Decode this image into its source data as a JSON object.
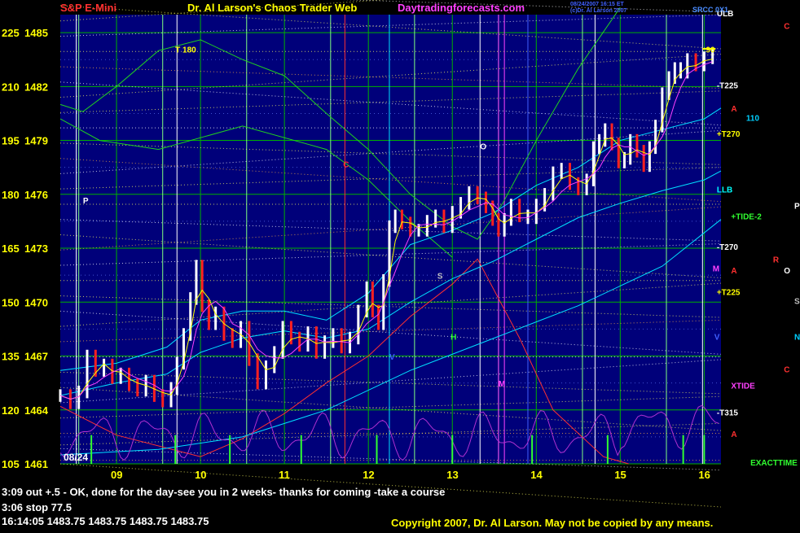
{
  "header": {
    "instrument": "S&P E-Mini",
    "title": "Dr. Al Larson's Chaos Trader Web",
    "site": "Daytradingforecasts.com",
    "timestamp_lines": [
      "08/24/2007 16:15 ET",
      "(c)Dr. Al Larson 2007"
    ],
    "corner_label": "SRCC 0X1",
    "colors": {
      "instrument": "#ff3030",
      "title": "#ffff00",
      "site": "#ff40ff",
      "timestamp": "#4060ff",
      "corner": "#4a8cff"
    }
  },
  "footer": {
    "note_line_1": "3:09 out +.5 - OK, done for the day-see you in 2 weeks- thanks for coming -take a course",
    "note_line_2": "3:06 stop 77.5",
    "quote_line": "16:14:05  1483.75 1483.75 1483.75 1483.75",
    "copyright": "Copyright 2007, Dr. Al Larson. May not be copied by any means."
  },
  "chart_data": {
    "type": "line",
    "date_label": "08/24",
    "x_ticks": [
      "09",
      "10",
      "11",
      "12",
      "13",
      "14",
      "15",
      "16"
    ],
    "x_tick_hours": [
      9,
      10,
      11,
      12,
      13,
      14,
      15,
      16
    ],
    "xlim": [
      8.33,
      16.2
    ],
    "ylim": [
      1461,
      1486
    ],
    "y_ticks": [
      {
        "offset": "225",
        "price": "1485",
        "value": 1485
      },
      {
        "offset": "210",
        "price": "1482",
        "value": 1482
      },
      {
        "offset": "195",
        "price": "1479",
        "value": 1479
      },
      {
        "offset": "180",
        "price": "1476",
        "value": 1476
      },
      {
        "offset": "165",
        "price": "1473",
        "value": 1473
      },
      {
        "offset": "150",
        "price": "1470",
        "value": 1470
      },
      {
        "offset": "135",
        "price": "1467",
        "value": 1467
      },
      {
        "offset": "120",
        "price": "1464",
        "value": 1464
      },
      {
        "offset": "105",
        "price": "1461",
        "value": 1461
      }
    ],
    "price_series": {
      "name": "",
      "color": "#ffffff",
      "x": [
        8.33,
        8.45,
        8.55,
        8.65,
        8.75,
        8.85,
        8.95,
        9.05,
        9.15,
        9.25,
        9.35,
        9.45,
        9.55,
        9.65,
        9.72,
        9.8,
        9.88,
        9.95,
        10.02,
        10.1,
        10.18,
        10.28,
        10.38,
        10.48,
        10.58,
        10.68,
        10.78,
        10.88,
        10.98,
        11.08,
        11.18,
        11.28,
        11.38,
        11.48,
        11.58,
        11.68,
        11.78,
        11.88,
        11.98,
        12.05,
        12.12,
        12.18,
        12.25,
        12.32,
        12.4,
        12.5,
        12.6,
        12.7,
        12.8,
        12.9,
        13.0,
        13.1,
        13.2,
        13.3,
        13.4,
        13.48,
        13.55,
        13.62,
        13.7,
        13.8,
        13.9,
        14.0,
        14.1,
        14.2,
        14.3,
        14.4,
        14.5,
        14.6,
        14.68,
        14.75,
        14.82,
        14.9,
        14.98,
        15.05,
        15.12,
        15.2,
        15.28,
        15.35,
        15.42,
        15.5,
        15.58,
        15.65,
        15.72,
        15.8,
        15.9,
        16.0,
        16.1
      ],
      "y": [
        1464.8,
        1464.4,
        1465.0,
        1467.0,
        1466.2,
        1466.5,
        1465.8,
        1466.0,
        1465.4,
        1465.1,
        1465.6,
        1464.8,
        1464.5,
        1465.2,
        1466.6,
        1468.2,
        1470.2,
        1472.0,
        1469.8,
        1468.8,
        1469.4,
        1468.2,
        1467.8,
        1468.6,
        1466.8,
        1465.5,
        1466.4,
        1467.2,
        1468.6,
        1468.0,
        1467.6,
        1468.3,
        1467.2,
        1467.8,
        1468.2,
        1467.5,
        1468.0,
        1469.5,
        1470.8,
        1469.5,
        1468.8,
        1471.2,
        1474.2,
        1474.8,
        1474.4,
        1474.0,
        1474.0,
        1474.5,
        1474.8,
        1474.2,
        1475.0,
        1475.5,
        1476.1,
        1475.8,
        1475.3,
        1474.6,
        1474.0,
        1474.6,
        1475.4,
        1474.8,
        1474.7,
        1475.4,
        1476.0,
        1477.2,
        1477.4,
        1476.6,
        1476.3,
        1476.8,
        1478.6,
        1479.0,
        1479.6,
        1478.8,
        1477.8,
        1478.0,
        1479.0,
        1478.4,
        1477.6,
        1478.6,
        1479.8,
        1481.6,
        1482.5,
        1483.0,
        1482.8,
        1483.5,
        1483.2,
        1483.6,
        1483.8
      ]
    },
    "annotations": [
      {
        "text": "T 180",
        "x": 9.7,
        "y": 1483.9,
        "color": "#ffff00"
      },
      {
        "text": "P",
        "x": 8.6,
        "y": 1475.5,
        "color": "#ffffff"
      },
      {
        "text": "C",
        "x": 11.7,
        "y": 1477.5,
        "color": "#ff3030"
      },
      {
        "text": "O",
        "x": 13.33,
        "y": 1478.5,
        "color": "#ffffff"
      },
      {
        "text": "S",
        "x": 12.82,
        "y": 1471.3,
        "color": "#c0c0c0"
      },
      {
        "text": "H",
        "x": 12.98,
        "y": 1467.9,
        "color": "#30ff30"
      },
      {
        "text": "M",
        "x": 13.55,
        "y": 1465.3,
        "color": "#ff40ff"
      },
      {
        "text": "ULB",
        "x": 16.15,
        "y": 1485.9,
        "color": "#ffffff"
      },
      {
        "text": "-T225",
        "x": 16.15,
        "y": 1481.9,
        "color": "#ffffff"
      },
      {
        "text": "110",
        "x": 16.5,
        "y": 1480.1,
        "color": "#00d0ff"
      },
      {
        "text": "+T270",
        "x": 16.15,
        "y": 1479.2,
        "color": "#ffff00"
      },
      {
        "text": "LLB",
        "x": 16.15,
        "y": 1476.1,
        "color": "#00ffff"
      },
      {
        "text": "+TIDE-2",
        "x": 16.32,
        "y": 1474.6,
        "color": "#30ff30"
      },
      {
        "text": "P",
        "x": 17.15,
        "y": 1475.2,
        "color": "#ffffff"
      },
      {
        "text": "-T270",
        "x": 16.15,
        "y": 1472.9,
        "color": "#ffffff"
      },
      {
        "text": "+T225",
        "x": 16.15,
        "y": 1470.4,
        "color": "#ffff00"
      },
      {
        "text": "O",
        "x": 16.95,
        "y": 1471.6,
        "color": "#ffffff"
      },
      {
        "text": "S",
        "x": 17.35,
        "y": 1469.9,
        "color": "#c0c0c0"
      },
      {
        "text": "N",
        "x": 17.55,
        "y": 1467.9,
        "color": "#00d0ff"
      },
      {
        "text": "XTIDE",
        "x": 16.32,
        "y": 1465.2,
        "color": "#ff40ff"
      },
      {
        "text": "-T315",
        "x": 16.15,
        "y": 1463.7,
        "color": "#ffffff"
      },
      {
        "text": "EXACTTIME",
        "x": 16.55,
        "y": 1460.9,
        "color": "#30ff30"
      },
      {
        "text": "C",
        "x": 16.95,
        "y": 1485.2,
        "color": "#ff3030"
      },
      {
        "text": "A",
        "x": 16.32,
        "y": 1480.6,
        "color": "#ff3030"
      },
      {
        "text": "A",
        "x": 16.32,
        "y": 1471.6,
        "color": "#ff3030"
      },
      {
        "text": "C",
        "x": 16.95,
        "y": 1466.1,
        "color": "#ff3030"
      },
      {
        "text": "A",
        "x": 16.32,
        "y": 1462.5,
        "color": "#ff3030"
      },
      {
        "text": "R",
        "x": 16.82,
        "y": 1472.2,
        "color": "#ff3030"
      },
      {
        "text": "M",
        "x": 16.1,
        "y": 1471.7,
        "color": "#ff40ff"
      },
      {
        "text": "V",
        "x": 16.12,
        "y": 1467.9,
        "color": "#4060ff"
      },
      {
        "text": "V",
        "x": 12.25,
        "y": 1466.8,
        "color": "#4060ff"
      },
      {
        "text": "90",
        "x": 16.02,
        "y": 1483.9,
        "color": "#ffff00"
      }
    ],
    "colors": {
      "plot_bg": "#00007a",
      "grid": "#00b000",
      "axis_text": "#ffff00",
      "price": "#ffffff",
      "down_bars": "#ff2020",
      "ma_short": "#ffff00",
      "ma_mid": "#ff40ff",
      "ma_long": "#00e0ff",
      "tide": "#b030d0",
      "red_curve": "#ff3030",
      "green_curve": "#20d020"
    }
  }
}
